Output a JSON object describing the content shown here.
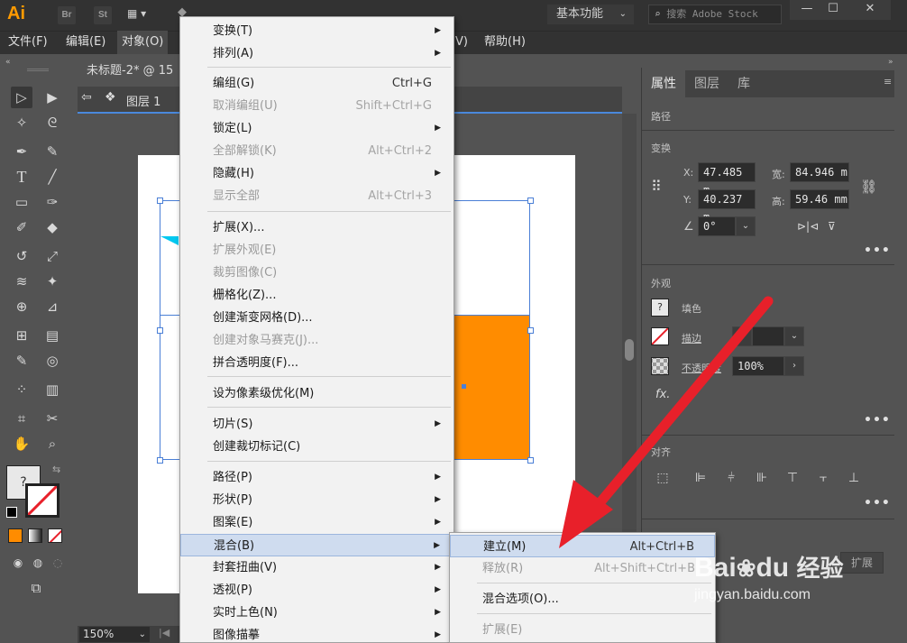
{
  "app": {
    "logo": "Ai",
    "bridge_icon": "Br",
    "stock_icon": "St",
    "workspace": "基本功能",
    "search_placeholder": "搜索 Adobe Stock"
  },
  "menubar": {
    "items": [
      "文件(F)",
      "编辑(E)",
      "对象(O)",
      "V)",
      "帮助(H)"
    ]
  },
  "document": {
    "tab_title": "未标题-2* @ 15",
    "layer": "图层 1",
    "zoom": "150%"
  },
  "object_menu": {
    "items": [
      {
        "label": "变换(T)",
        "shortcut": "",
        "submenu": true,
        "disabled": false
      },
      {
        "label": "排列(A)",
        "shortcut": "",
        "submenu": true,
        "disabled": false
      },
      {
        "label": "编组(G)",
        "shortcut": "Ctrl+G",
        "submenu": false,
        "disabled": false
      },
      {
        "label": "取消编组(U)",
        "shortcut": "Shift+Ctrl+G",
        "submenu": false,
        "disabled": true
      },
      {
        "label": "锁定(L)",
        "shortcut": "",
        "submenu": true,
        "disabled": false
      },
      {
        "label": "全部解锁(K)",
        "shortcut": "Alt+Ctrl+2",
        "submenu": false,
        "disabled": true
      },
      {
        "label": "隐藏(H)",
        "shortcut": "",
        "submenu": true,
        "disabled": false
      },
      {
        "label": "显示全部",
        "shortcut": "Alt+Ctrl+3",
        "submenu": false,
        "disabled": true
      },
      {
        "label": "扩展(X)...",
        "shortcut": "",
        "submenu": false,
        "disabled": false
      },
      {
        "label": "扩展外观(E)",
        "shortcut": "",
        "submenu": false,
        "disabled": true
      },
      {
        "label": "裁剪图像(C)",
        "shortcut": "",
        "submenu": false,
        "disabled": true
      },
      {
        "label": "栅格化(Z)...",
        "shortcut": "",
        "submenu": false,
        "disabled": false
      },
      {
        "label": "创建渐变网格(D)...",
        "shortcut": "",
        "submenu": false,
        "disabled": false
      },
      {
        "label": "创建对象马赛克(J)...",
        "shortcut": "",
        "submenu": false,
        "disabled": true
      },
      {
        "label": "拼合透明度(F)...",
        "shortcut": "",
        "submenu": false,
        "disabled": false
      },
      {
        "label": "设为像素级优化(M)",
        "shortcut": "",
        "submenu": false,
        "disabled": false
      },
      {
        "label": "切片(S)",
        "shortcut": "",
        "submenu": true,
        "disabled": false
      },
      {
        "label": "创建裁切标记(C)",
        "shortcut": "",
        "submenu": false,
        "disabled": false
      },
      {
        "label": "路径(P)",
        "shortcut": "",
        "submenu": true,
        "disabled": false
      },
      {
        "label": "形状(P)",
        "shortcut": "",
        "submenu": true,
        "disabled": false
      },
      {
        "label": "图案(E)",
        "shortcut": "",
        "submenu": true,
        "disabled": false
      },
      {
        "label": "混合(B)",
        "shortcut": "",
        "submenu": true,
        "disabled": false
      },
      {
        "label": "封套扭曲(V)",
        "shortcut": "",
        "submenu": true,
        "disabled": false
      },
      {
        "label": "透视(P)",
        "shortcut": "",
        "submenu": true,
        "disabled": false
      },
      {
        "label": "实时上色(N)",
        "shortcut": "",
        "submenu": true,
        "disabled": false
      },
      {
        "label": "图像描摹",
        "shortcut": "",
        "submenu": true,
        "disabled": false
      }
    ]
  },
  "blend_submenu": {
    "items": [
      {
        "label": "建立(M)",
        "shortcut": "Alt+Ctrl+B",
        "disabled": false
      },
      {
        "label": "释放(R)",
        "shortcut": "Alt+Shift+Ctrl+B",
        "disabled": true
      },
      {
        "label": "混合选项(O)...",
        "shortcut": "",
        "disabled": false
      },
      {
        "label": "扩展(E)",
        "shortcut": "",
        "disabled": true
      }
    ]
  },
  "properties_panel": {
    "tabs": [
      "属性",
      "图层",
      "库"
    ],
    "selection_type": "路径",
    "transform": {
      "title": "变换",
      "x_label": "X:",
      "x": "47.485 m",
      "y_label": "Y:",
      "y": "40.237 m",
      "w_label": "宽:",
      "w": "84.946 m",
      "h_label": "高:",
      "h": "59.46 mm",
      "angle": "0°"
    },
    "appearance": {
      "title": "外观",
      "fill_label": "填色",
      "stroke_label": "描边",
      "opacity_label": "不透明度",
      "opacity": "100%",
      "fx": "fx."
    },
    "align": {
      "title": "对齐"
    },
    "expand_button": "扩展"
  },
  "watermark": {
    "brand": "Bai",
    "brand2": "du",
    "cn": "经验",
    "url": "jingyan.baidu.com"
  },
  "colors": {
    "orange": "#ff8c00",
    "cyan": "#00c8f0",
    "selection_blue": "#4a7fd6",
    "arrow_red": "#e8202a"
  }
}
